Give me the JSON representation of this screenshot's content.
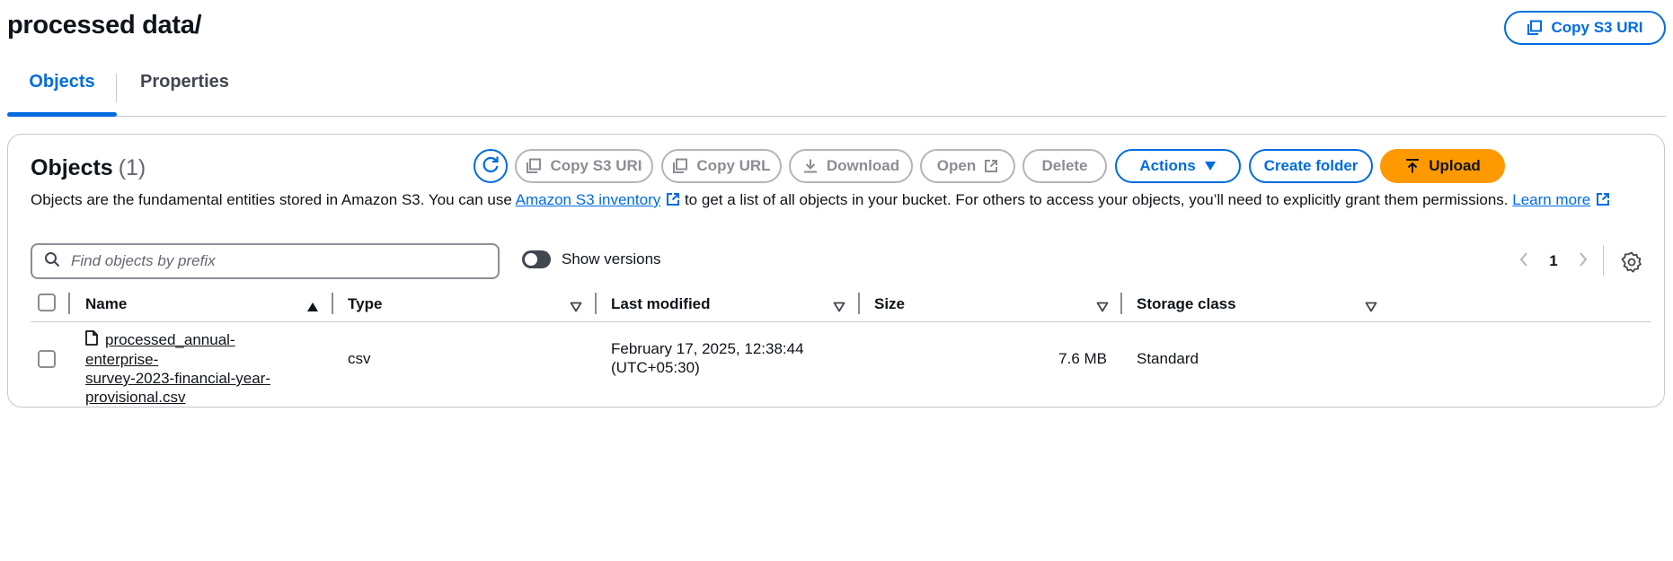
{
  "header": {
    "title": "processed data/",
    "copy_s3_uri_label": "Copy S3 URI"
  },
  "tabs": [
    {
      "label": "Objects",
      "active": true
    },
    {
      "label": "Properties",
      "active": false
    }
  ],
  "objects_panel": {
    "title": "Objects",
    "count": "(1)",
    "toolbar": {
      "refresh_icon": "refresh-icon",
      "copy_s3_uri": "Copy S3 URI",
      "copy_url": "Copy URL",
      "download": "Download",
      "open": "Open",
      "delete": "Delete",
      "actions": "Actions",
      "create_folder": "Create folder",
      "upload": "Upload"
    },
    "description": {
      "part1": "Objects are the fundamental entities stored in Amazon S3. You can use ",
      "link1": "Amazon S3 inventory",
      "part2": " to get a list of all objects in your bucket. For others to access your objects, you’ll need to explicitly grant them permissions. ",
      "link2": "Learn more"
    },
    "search": {
      "placeholder": "Find objects by prefix",
      "value": ""
    },
    "show_versions": {
      "label": "Show versions",
      "enabled": false
    },
    "pagination": {
      "current_page": "1"
    },
    "table": {
      "columns": [
        "Name",
        "Type",
        "Last modified",
        "Size",
        "Storage class"
      ],
      "rows": [
        {
          "name_line1": "processed_annual-enterprise-",
          "name_line2": "survey-2023-financial-year-",
          "name_line3": "provisional.csv",
          "type": "csv",
          "last_modified_line1": "February 17, 2025, 12:38:44",
          "last_modified_line2": "(UTC+05:30)",
          "size": "7.6 MB",
          "storage_class": "Standard"
        }
      ]
    }
  },
  "colors": {
    "accent": "#006ce0",
    "upload": "#ff9900",
    "text": "#0f141a",
    "disabled": "#8c8c94"
  }
}
